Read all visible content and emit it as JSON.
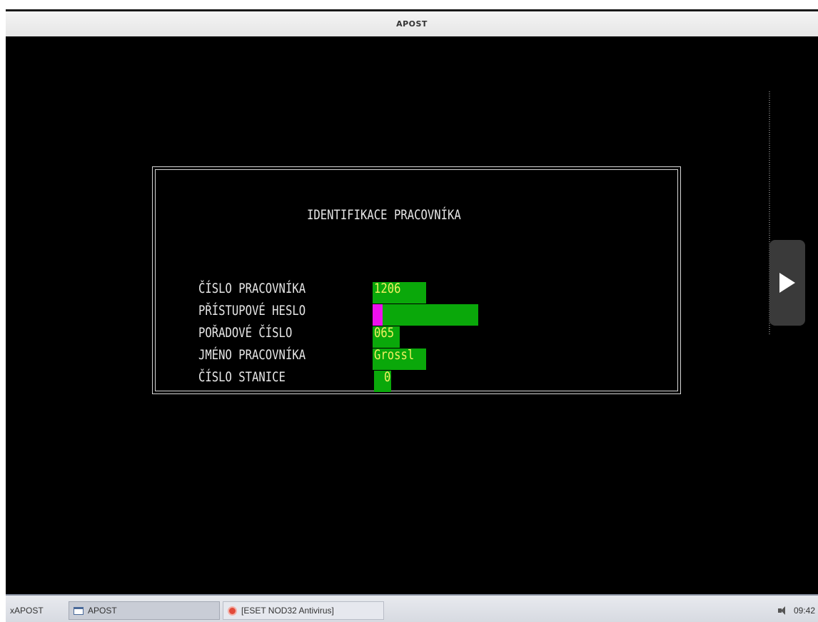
{
  "window": {
    "title": "APOST"
  },
  "dialog": {
    "title": "IDENTIFIKACE PRACOVNÍKA",
    "fields": [
      {
        "label": "ČÍSLO PRACOVNÍKA",
        "value": "1206"
      },
      {
        "label": "PŘÍSTUPOVÉ HESLO",
        "value": ""
      },
      {
        "label": "POŘADOVÉ ČÍSLO",
        "value": "065"
      },
      {
        "label": "JMÉNO PRACOVNÍKA",
        "value": "Grossl"
      },
      {
        "label": "ČÍSLO STANICE",
        "value": "0"
      }
    ]
  },
  "side_button": {
    "icon": "play-icon"
  },
  "taskbar": {
    "start_label": "xAPOST",
    "items": [
      {
        "label": "APOST",
        "icon": "window-icon",
        "active": true
      },
      {
        "label": "[ESET NOD32 Antivirus]",
        "icon": "eset-icon",
        "active": false
      }
    ],
    "clock": "09:42"
  },
  "colors": {
    "terminal_bg": "#000000",
    "field_bg": "#0aa80a",
    "field_text": "#f0f060",
    "cursor": "#ee10ee",
    "label_text": "#e8e8e8"
  }
}
